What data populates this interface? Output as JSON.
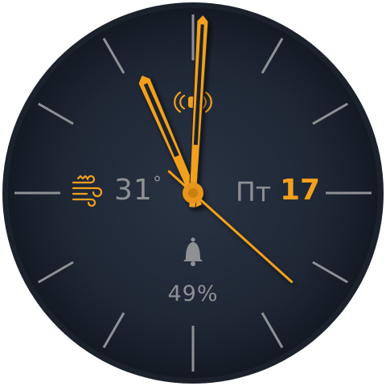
{
  "watchface": {
    "weather": {
      "icon": "windy-weather-icon",
      "temperature": "31",
      "unit": "°"
    },
    "date": {
      "weekday": "Пт",
      "day": "17"
    },
    "battery": {
      "icon": "bell-icon",
      "level": "49%"
    },
    "status_icon": "vibration-icon",
    "time": {
      "hour": 11,
      "minute": 1,
      "second": 52
    }
  },
  "colors": {
    "accent": "#f2a01d",
    "text_gray": "#8e9094",
    "tick": "#8f9195",
    "dial_center": "#27303f",
    "dial_edge": "#151b25",
    "bezel": "#1e252f"
  }
}
